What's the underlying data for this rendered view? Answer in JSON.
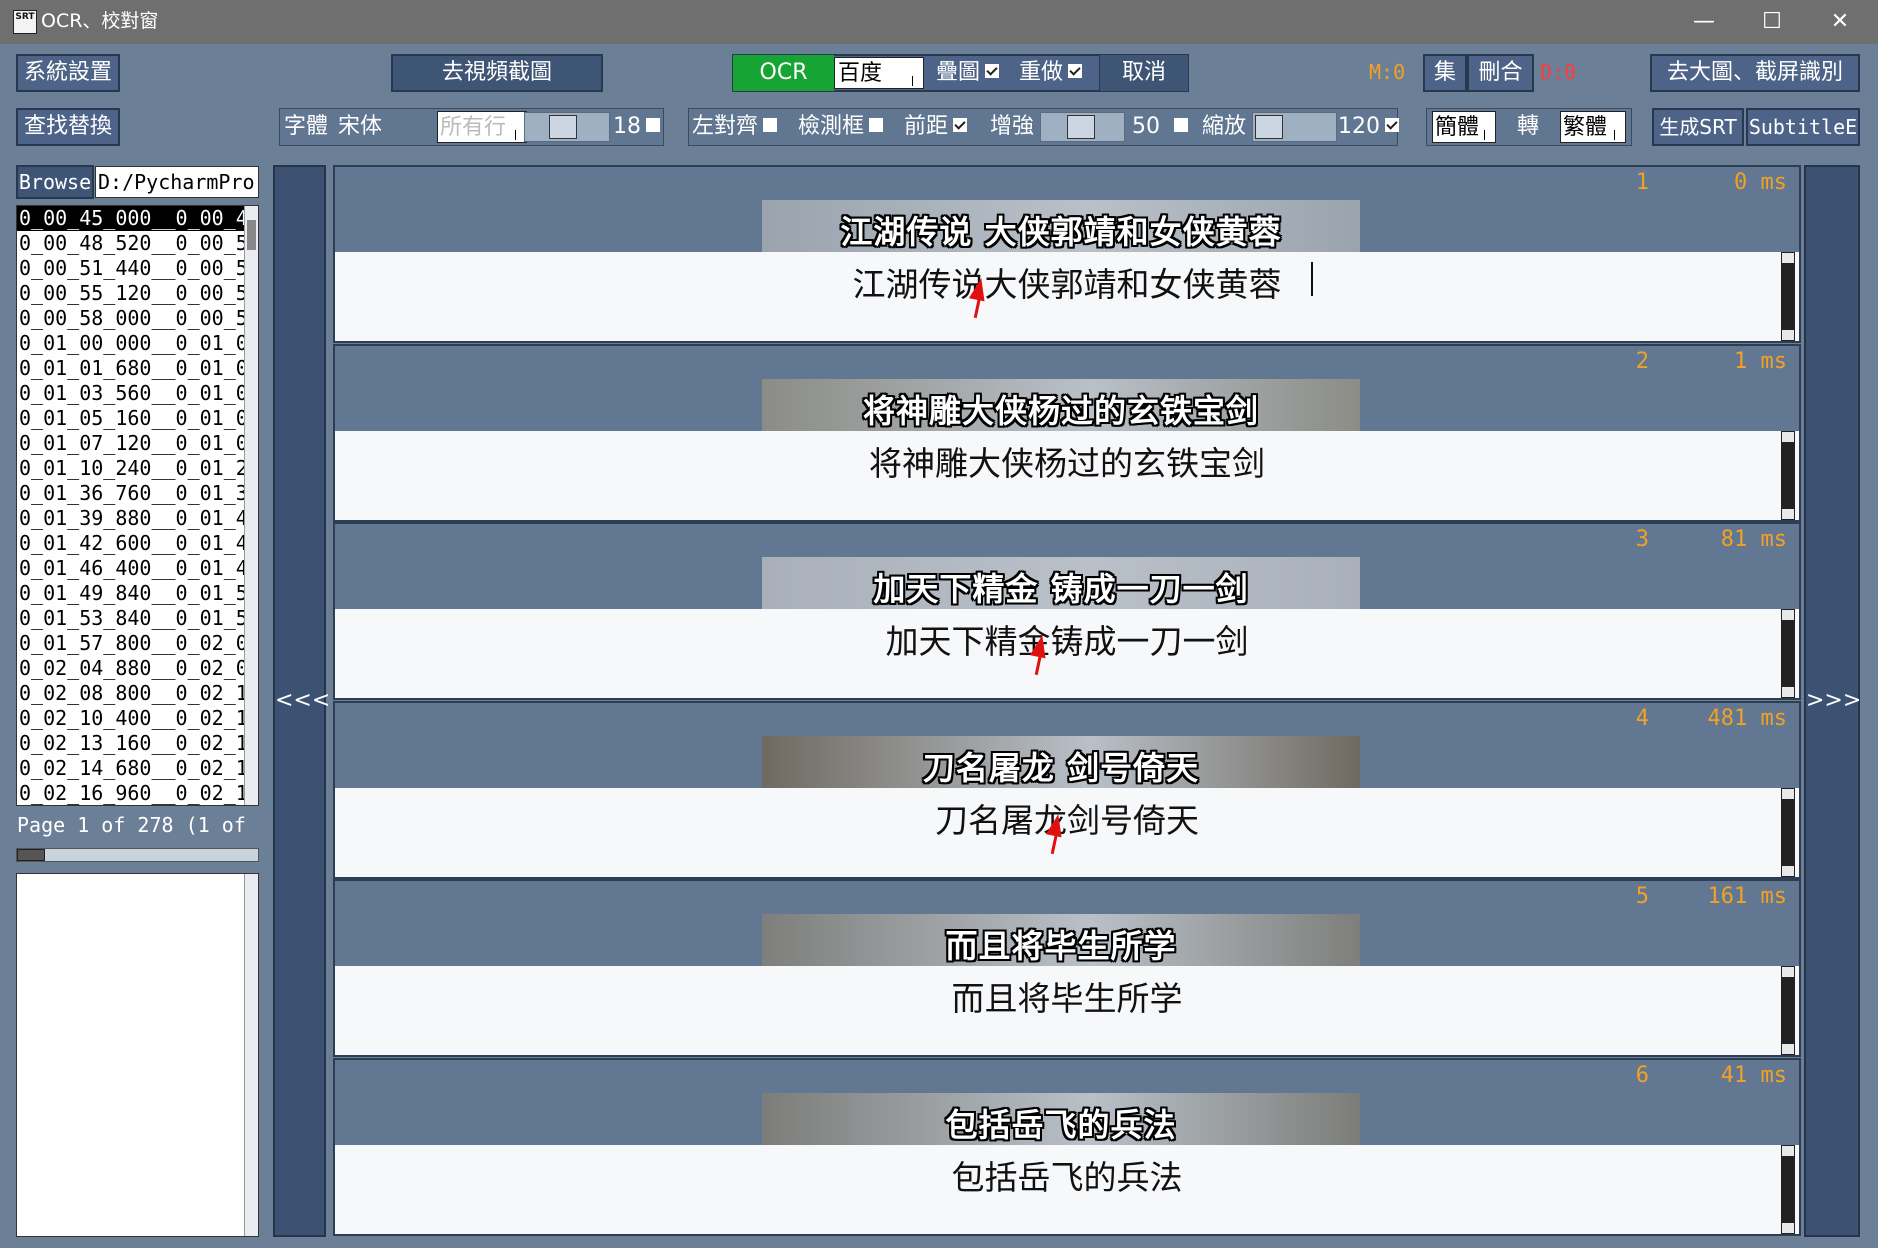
{
  "window": {
    "title": "OCR、校對窗",
    "icon_text": "SRT",
    "minimize": "—",
    "maximize": "☐",
    "close": "✕"
  },
  "toolbar1": {
    "system_settings": "系統設置",
    "go_video_capture": "去視頻截圖",
    "ocr": "OCR",
    "ocr_engine": "百度",
    "overlay": "疊圖",
    "overlay_checked": true,
    "redo": "重做",
    "redo_checked": true,
    "cancel": "取消",
    "m_count": "M:0",
    "collect": "集",
    "delete_merge": "刪合",
    "d_count": "D:0",
    "go_big_screenshot": "去大圖、截屏識別"
  },
  "toolbar2": {
    "find_replace": "查找替換",
    "font_label": "字體",
    "font_name": "宋体",
    "all_rows": "所有行",
    "font_size": "18",
    "align_left": "左對齊",
    "detect_box": "檢測框",
    "front_distance": "前距",
    "enhance": "增強",
    "enhance_value": "50",
    "zoom": "縮放",
    "zoom_value": "120",
    "simplified": "簡體",
    "convert": "轉",
    "traditional": "繁體",
    "gen_srt": "生成SRT",
    "subtitle_edit": "SubtitleE"
  },
  "browse": {
    "button": "Browse",
    "path": "D:/PycharmPro"
  },
  "file_list": [
    "0_00_45_000__0_00_4",
    "0_00_48_520__0_00_5",
    "0_00_51_440__0_00_5",
    "0_00_55_120__0_00_5",
    "0_00_58_000__0_00_5",
    "0_01_00_000__0_01_0",
    "0_01_01_680__0_01_0",
    "0_01_03_560__0_01_0",
    "0_01_05_160__0_01_0",
    "0_01_07_120__0_01_0",
    "0_01_10_240__0_01_2",
    "0_01_36_760__0_01_3",
    "0_01_39_880__0_01_4",
    "0_01_42_600__0_01_4",
    "0_01_46_400__0_01_4",
    "0_01_49_840__0_01_5",
    "0_01_53_840__0_01_5",
    "0_01_57_800__0_02_0",
    "0_02_04_880__0_02_0",
    "0_02_08_800__0_02_1",
    "0_02_10_400__0_02_1",
    "0_02_13_160__0_02_1",
    "0_02_14_680__0_02_1",
    "0_02_16_960__0_02_1"
  ],
  "pagination": {
    "text": "Page 1 of 278 (1 of"
  },
  "nav": {
    "prev": "<<<",
    "next": ">>>"
  },
  "subtitles": [
    {
      "num": "1",
      "ms": "0 ms",
      "image_text": "江湖传说  大侠郭靖和女侠黄蓉",
      "edit_text": "江湖传说大侠郭靖和女侠黄蓉",
      "img_bg": "#9aa3ae"
    },
    {
      "num": "2",
      "ms": "1 ms",
      "image_text": "将神雕大侠杨过的玄铁宝剑",
      "edit_text": "将神雕大侠杨过的玄铁宝剑",
      "img_bg": "#8b8c86"
    },
    {
      "num": "3",
      "ms": "81 ms",
      "image_text": "加天下精金  铸成一刀一剑",
      "edit_text": "加天下精金铸成一刀一剑",
      "img_bg": "#a9b0ba"
    },
    {
      "num": "4",
      "ms": "481 ms",
      "image_text": "刀名屠龙  剑号倚天",
      "edit_text": "刀名屠龙剑号倚天",
      "img_bg": "#6f6a61"
    },
    {
      "num": "5",
      "ms": "161 ms",
      "image_text": "而且将毕生所学",
      "edit_text": "而且将毕生所学",
      "img_bg": "#7e7f7c"
    },
    {
      "num": "6",
      "ms": "41 ms",
      "image_text": "包括岳飞的兵法",
      "edit_text": "包括岳飞的兵法",
      "img_bg": "#7c7d7a"
    }
  ],
  "colors": {
    "ocr_green": "#16a534",
    "accent_orange": "#f2a125",
    "delete_red": "#ff3b3b",
    "panel": "#627792"
  }
}
